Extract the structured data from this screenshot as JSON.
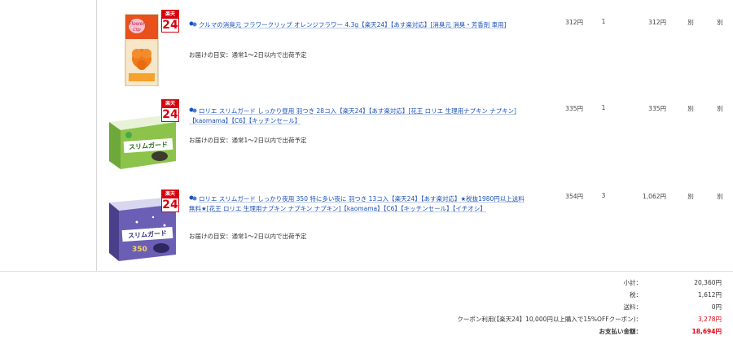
{
  "items": [
    {
      "title": "クルマの消臭元 フラワークリップ オレンジフラワー 4.3g【楽天24】【あす楽対応】[消臭元 消臭・芳香剤 車用]",
      "delivery": "お届けの目安：通常1～2日以内で出荷予定",
      "price": "312円",
      "qty": "1",
      "subtotal": "312円",
      "col_a": "別",
      "col_b": "別",
      "badge_top": "楽天",
      "badge_num": "24",
      "product_icon": "orange-flower-car-freshener",
      "accent": "#e8501c"
    },
    {
      "title": "ロリエ スリムガード しっかり昼用 羽つき 28コ入【楽天24】【あす楽対応】[花王 ロリエ 生理用ナプキン ナプキン]【kaomama】【C6】【キッチンセール】",
      "delivery": "お届けの目安：通常1～2日以内で出荷予定",
      "price": "335円",
      "qty": "1",
      "subtotal": "335円",
      "col_a": "別",
      "col_b": "別",
      "badge_top": "楽天",
      "badge_num": "24",
      "pkg_brand": "スリムガード",
      "product_icon": "green-sanitary-pad-box",
      "accent": "#7cb342"
    },
    {
      "title": "ロリエ スリムガード しっかり夜用 350 特に多い夜に 羽つき 13コ入【楽天24】【あす楽対応】★税抜1980円以上送料無料★[花王 ロリエ 生理用ナプキン ナプキン ナプキン]【kaomama】【C6】【キッチンセール】【イチオシ】",
      "delivery": "お届けの目安：通常1～2日以内で出荷予定",
      "price": "354円",
      "qty": "3",
      "subtotal": "1,062円",
      "col_a": "別",
      "col_b": "別",
      "badge_top": "楽天",
      "badge_num": "24",
      "pkg_brand": "スリムガード",
      "pkg_size": "350",
      "product_icon": "purple-night-pad-box",
      "accent": "#5c4f9e"
    }
  ],
  "summary": {
    "subtotal_label": "小計：",
    "subtotal_value": "20,360円",
    "tax_label": "税：",
    "tax_value": "1,612円",
    "shipping_label": "送料：",
    "shipping_value": "0円",
    "coupon_label": "クーポン利用(【楽天24】10,000円以上購入で15%OFFクーポン)：",
    "coupon_value": "3,278円",
    "total_label": "お支払い金額：",
    "total_value": "18,694円"
  },
  "colors": {
    "link": "#1c52b8",
    "discount": "#e60012",
    "badge_red": "#d7000f",
    "divider": "#d8d8d8"
  }
}
